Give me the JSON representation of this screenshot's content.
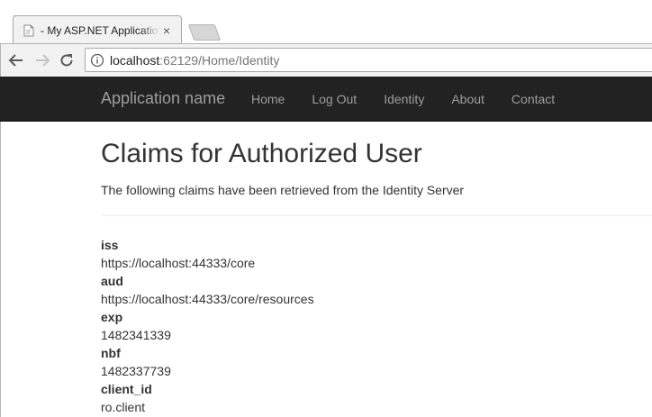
{
  "browser": {
    "tab_title": "- My ASP.NET Application",
    "tab_close": "×",
    "url_host": "localhost",
    "url_rest": ":62129/Home/Identity"
  },
  "navbar": {
    "brand": "Application name",
    "links": [
      "Home",
      "Log Out",
      "Identity",
      "About",
      "Contact"
    ]
  },
  "page": {
    "title": "Claims for Authorized User",
    "subtitle": "The following claims have been retrieved from the Identity Server"
  },
  "claims": [
    {
      "type": "iss",
      "value": "https://localhost:44333/core"
    },
    {
      "type": "aud",
      "value": "https://localhost:44333/core/resources"
    },
    {
      "type": "exp",
      "value": "1482341339"
    },
    {
      "type": "nbf",
      "value": "1482337739"
    },
    {
      "type": "client_id",
      "value": "ro.client"
    }
  ],
  "colors": {
    "navbar_bg": "#222222",
    "navbar_text": "#9d9d9d",
    "body_text": "#333333"
  }
}
